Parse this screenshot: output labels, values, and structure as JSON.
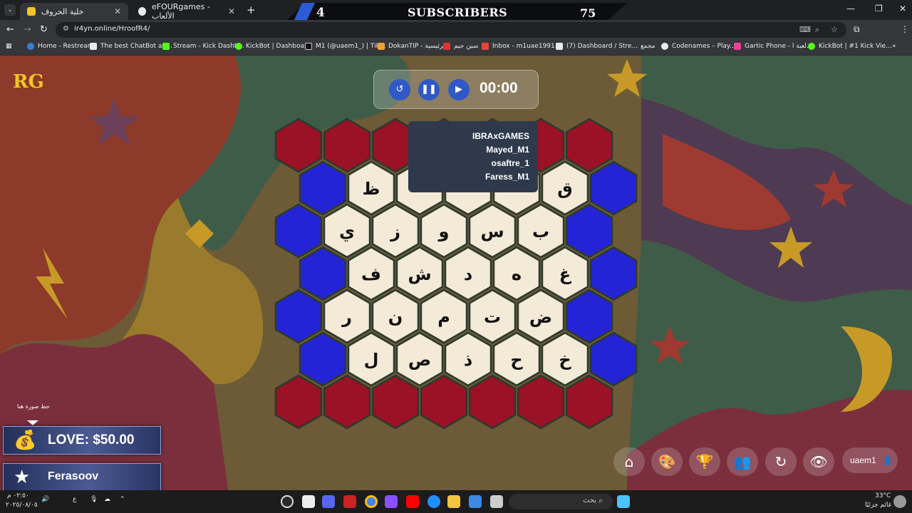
{
  "tabs": [
    {
      "title": "خلية الحروف",
      "active": true
    },
    {
      "title": "eFOURgames - الألعاب",
      "active": false
    }
  ],
  "stream_bar": {
    "left_count": "4",
    "label": "SUBSCRIBERS",
    "right_count": "75"
  },
  "address": {
    "url": "ir4yn.online/HroofR4/"
  },
  "bookmarks": [
    "Home - Restream",
    "The best ChatBot an...",
    "Stream - Kick Dashb...",
    "KickBot | Dashboard",
    "M1 (@uaem1_) | Tik...",
    "DokanTIP - الرئيسية",
    "سين جيم",
    "Inbox - m1uae1991...",
    "(7) Dashboard / Stre...",
    "مجمع",
    "Codenames – Play...",
    "Gartic Phone - لعبة ا...",
    "KickBot | #1 Kick Vie..."
  ],
  "timer": {
    "display": "00:00"
  },
  "players": [
    "IBRAxGAMES",
    "Mayed_M1",
    "osaftre_1",
    "Faress_M1"
  ],
  "board": {
    "colors": {
      "red": "#9b1126",
      "blue": "#2424d6",
      "cell": "#f3ead7"
    },
    "letters": [
      [
        "ظ",
        "",
        "",
        "",
        "ق"
      ],
      [
        "ي",
        "ز",
        "و",
        "س",
        "ب"
      ],
      [
        "ف",
        "ش",
        "د",
        "ه",
        "غ"
      ],
      [
        "ر",
        "ن",
        "م",
        "ت",
        "ض"
      ],
      [
        "ل",
        "ص",
        "ذ",
        "ح",
        "خ"
      ]
    ]
  },
  "overlay": {
    "image_caption": "حط صورة هنا",
    "donation": "LOVE: $50.00",
    "follower": "Ferasoov"
  },
  "controls": {
    "username": "uaem1"
  },
  "taskbar": {
    "search_placeholder": "بحث",
    "weather_temp": "33°C",
    "weather_desc": "غائم جزئيًا",
    "time": "٠٢:٥٠ م",
    "date": "٢٠٢٥/٠٨/٠٥",
    "lang": "ع"
  }
}
